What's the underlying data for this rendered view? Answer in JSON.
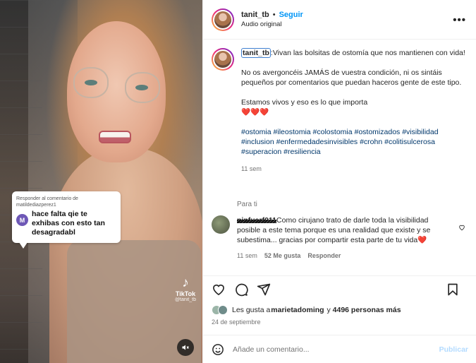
{
  "video": {
    "reply_header": "Responder al comentario de matildediazperez1",
    "reply_avatar_letter": "M",
    "reply_text": "hace falta qie te exhibas con esto tan desagradabl",
    "tiktok_name": "TikTok",
    "tiktok_user": "@tanit_tb"
  },
  "header": {
    "username": "tanit_tb",
    "dot": "•",
    "follow": "Seguir",
    "audio": "Audio original",
    "more": "•••"
  },
  "caption": {
    "username": "tanit_tb",
    "p1": ":Vivan las bolsitas de ostomía que nos mantienen con vida!",
    "p2": "No os avergoncéis JAMÁS de vuestra condición, ni os sintáis pequeños por comentarios que puedan haceros gente de este tipo.",
    "p3": "Estamos vivos y eso es lo que importa",
    "hearts": "❤️❤️❤️",
    "hashtags": "#ostomia #ileostomia #colostomia #ostomizados #visibilidad #inclusion #enfermedadesinvisibles #crohn #colitisulcerosa #superacion #resiliencia",
    "time": "11 sem"
  },
  "translate": "Para ti",
  "comment": {
    "username": "ninfuarf011",
    "text": "Como cirujano trato de darle toda la visibilidad posible a este tema porque es una realidad que existe y se subestima... gracias por compartir esta parte de tu vida❤️",
    "time": "11 sem",
    "likes": "52 Me gusta",
    "reply": "Responder"
  },
  "likes": {
    "prefix": "Les gusta a ",
    "user": "marietadoming",
    "middle": " y ",
    "count": "4496 personas más"
  },
  "date": "24 de septiembre",
  "composer": {
    "placeholder": "Añade un comentario...",
    "publish": "Publicar"
  }
}
